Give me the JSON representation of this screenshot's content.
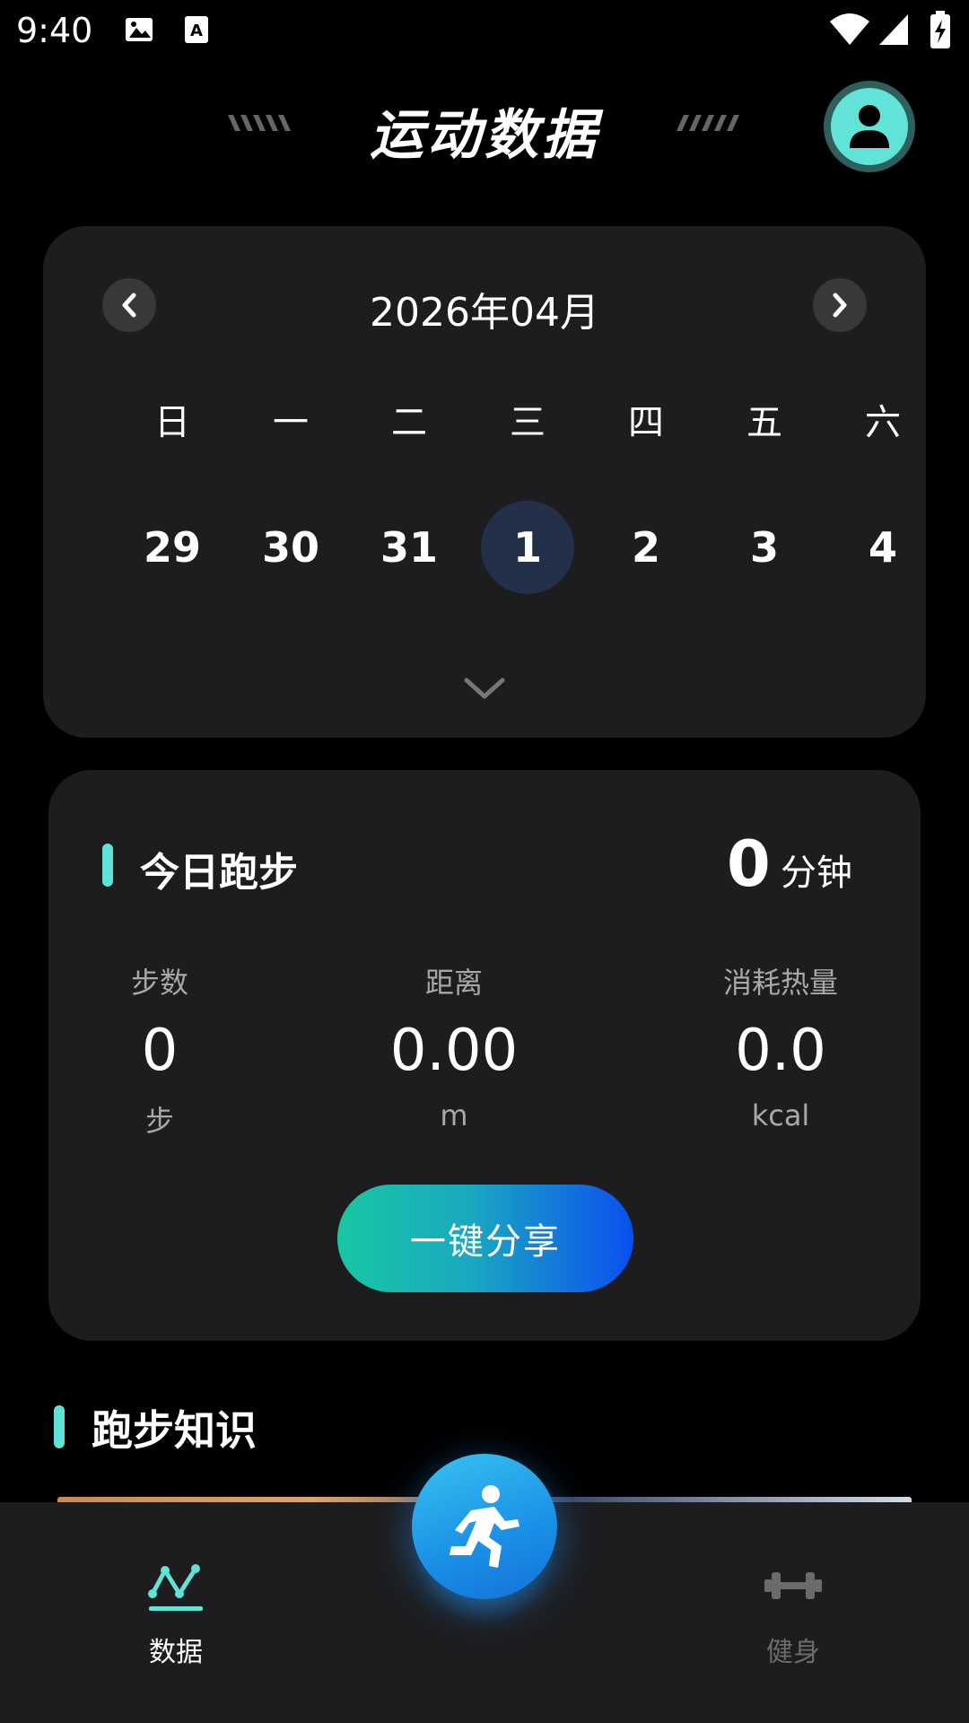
{
  "status_bar": {
    "time": "9:40"
  },
  "header": {
    "title": "运动数据"
  },
  "calendar": {
    "month_label": "2026年04月",
    "weekdays": [
      "日",
      "一",
      "二",
      "三",
      "四",
      "五",
      "六"
    ],
    "days": [
      "29",
      "30",
      "31",
      "1",
      "2",
      "3",
      "4"
    ],
    "selected_day": "1"
  },
  "run": {
    "title": "今日跑步",
    "minutes_value": "0",
    "minutes_unit": "分钟",
    "stats": [
      {
        "label": "步数",
        "value": "0",
        "unit": "步"
      },
      {
        "label": "距离",
        "value": "0.00",
        "unit": "m"
      },
      {
        "label": "消耗热量",
        "value": "0.0",
        "unit": "kcal"
      }
    ],
    "share_label": "一键分享"
  },
  "knowledge": {
    "title": "跑步知识"
  },
  "bottom_nav": {
    "items": [
      {
        "label": "数据",
        "icon": "chart-line-icon",
        "active": true
      },
      {
        "label": "健身",
        "icon": "dumbbell-icon",
        "active": false
      }
    ],
    "fab_icon": "running-person-icon"
  },
  "colors": {
    "accent": "#5fe3d7",
    "card": "#1d1d1f",
    "selected_day": "#23304a",
    "fab": "#1a8fe6"
  }
}
